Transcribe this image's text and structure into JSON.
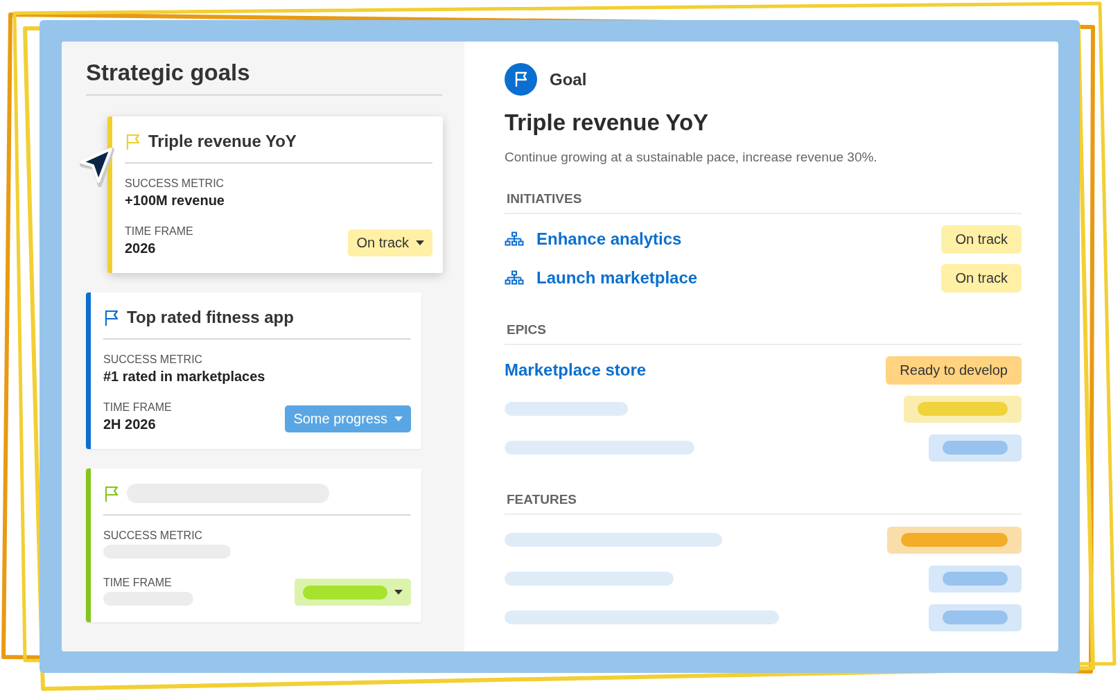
{
  "sidebar": {
    "title": "Strategic goals",
    "goals": [
      {
        "kind": "filled",
        "selected": true,
        "color": "#f0cf2f",
        "title": "Triple revenue YoY",
        "metric_label": "SUCCESS METRIC",
        "metric": "+100M revenue",
        "time_label": "TIME FRAME",
        "time": "2026",
        "status": {
          "label": "On track",
          "color": "#fff0a6"
        }
      },
      {
        "kind": "filled",
        "selected": false,
        "color": "#0b6fd0",
        "title": "Top rated fitness app",
        "metric_label": "SUCCESS METRIC",
        "metric": "#1 rated in marketplaces",
        "time_label": "TIME FRAME",
        "time": "2H 2026",
        "status": {
          "label": "Some progress",
          "color": "#5aa6e4"
        }
      },
      {
        "kind": "skeleton",
        "selected": false,
        "color": "#84c51c",
        "metric_label": "SUCCESS METRIC",
        "time_label": "TIME FRAME",
        "status": {
          "color": "#a6e22e"
        }
      }
    ]
  },
  "detail": {
    "type_label": "Goal",
    "title": "Triple revenue YoY",
    "description": "Continue growing at a sustainable pace, increase revenue 30%.",
    "sections": [
      {
        "heading": "INITIATIVES",
        "items": [
          {
            "kind": "initiative",
            "label": "Enhance analytics",
            "status": {
              "label": "On track",
              "color": "#fff0a6"
            }
          },
          {
            "kind": "initiative",
            "label": "Launch marketplace",
            "status": {
              "label": "On track",
              "color": "#fff0a6"
            }
          }
        ]
      },
      {
        "heading": "EPICS",
        "items": [
          {
            "kind": "epic",
            "label": "Marketplace store",
            "status": {
              "label": "Ready to develop",
              "color": "#ffd37f"
            }
          },
          {
            "kind": "skeleton",
            "status": {
              "color": "#f0d23a"
            }
          },
          {
            "kind": "skeleton",
            "status": {
              "color": "#97c3ee"
            }
          }
        ]
      },
      {
        "heading": "FEATURES",
        "items": [
          {
            "kind": "skeleton",
            "status": {
              "color": "#f3ad29"
            }
          },
          {
            "kind": "skeleton",
            "status": {
              "color": "#97c3ee"
            }
          },
          {
            "kind": "skeleton",
            "status": {
              "color": "#97c3ee"
            }
          }
        ]
      }
    ]
  }
}
